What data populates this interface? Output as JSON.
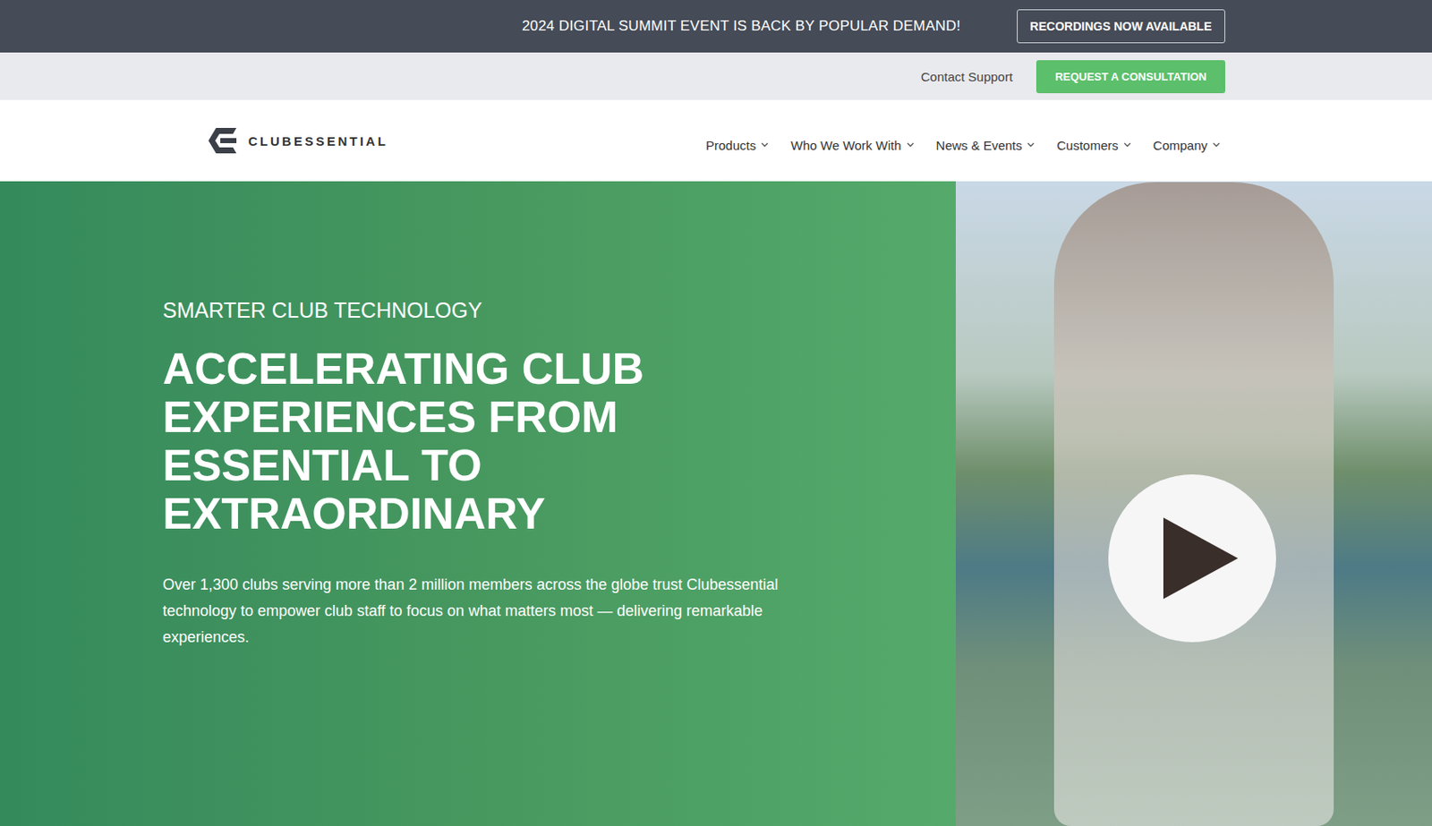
{
  "announcement": {
    "text": "2024 DIGITAL SUMMIT EVENT IS BACK BY POPULAR DEMAND!",
    "button": "RECORDINGS NOW AVAILABLE"
  },
  "utility_bar": {
    "link": "Contact Support",
    "button": "REQUEST A CONSULTATION"
  },
  "logo": {
    "text": "CLUBESSENTIAL"
  },
  "nav": {
    "items": [
      {
        "label": "Products",
        "expanded": false
      },
      {
        "label": "Who We Work With",
        "expanded": false
      },
      {
        "label": "News & Events",
        "expanded": false
      },
      {
        "label": "Customers",
        "expanded": false
      },
      {
        "label": "Company",
        "expanded": false
      }
    ]
  },
  "hero": {
    "eyebrow": "SMARTER CLUB TECHNOLOGY",
    "heading": [
      "ACCELERATING CLUB",
      "EXPERIENCES FROM",
      "ESSENTIAL TO",
      "EXTRAORDINARY"
    ],
    "body": "Over 1,300 clubs serving more than 2 million members across the globe trust Clubessential technology to empower club staff to focus on what matters most — delivering remarkable experiences."
  }
}
